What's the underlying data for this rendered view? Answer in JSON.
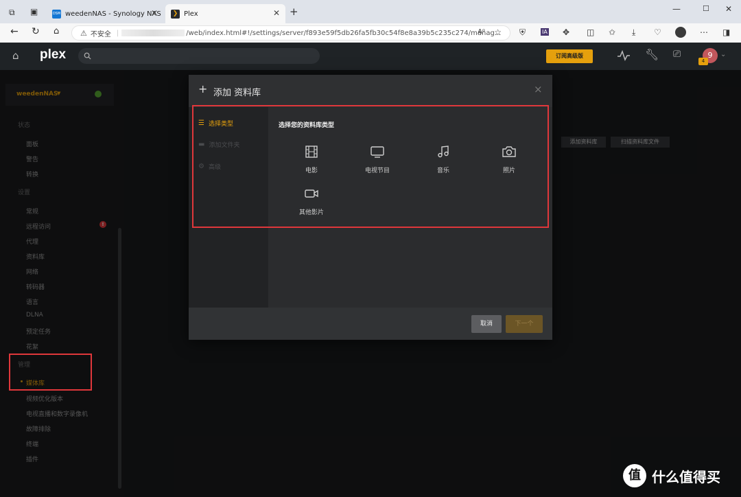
{
  "browser": {
    "tabs": [
      {
        "title": "weedenNAS - Synology NAS",
        "favicon": "DSM",
        "active": false
      },
      {
        "title": "Plex",
        "favicon": "plex-chevron",
        "active": true
      }
    ],
    "new_tab": "+",
    "security_label": "不安全",
    "url": "/web/index.html#!/settings/server/f893e59f5db26fa5fb30c54f8e8a39b5c235c274/manag..."
  },
  "topbar": {
    "logo": "plex",
    "search_placeholder": "",
    "premium_button": "订阅高级版",
    "avatar_letter": "9",
    "badge_count": "4"
  },
  "sidebar": {
    "server_name": "weedenNAS",
    "sections": [
      {
        "heading": "状态",
        "items": [
          "面板",
          "警告",
          "转换"
        ]
      },
      {
        "heading": "设置",
        "items": [
          "常规",
          "远程访问",
          "代理",
          "资料库",
          "网络",
          "转码器",
          "语言",
          "DLNA",
          "预定任务",
          "花絮"
        ]
      },
      {
        "heading": "管理",
        "items": [
          "媒体库",
          "视频优化版本",
          "电视直播和数字录像机",
          "故障排除",
          "终端",
          "插件"
        ]
      }
    ],
    "active_item": "媒体库"
  },
  "background_actions": {
    "add_library": "添加资料库",
    "scan_library": "扫描资料库文件"
  },
  "modal": {
    "title": "添加 资料库",
    "close": "×",
    "steps": [
      "选择类型",
      "添加文件夹",
      "高级"
    ],
    "prompt": "选择您的资料库类型",
    "types": [
      "电影",
      "电视节目",
      "音乐",
      "照片",
      "其他影片"
    ],
    "cancel": "取消",
    "next": "下一个"
  },
  "colors": {
    "accent": "#e5a00d",
    "alert": "#e0373b",
    "online": "#58a832"
  },
  "watermark": "什么值得买"
}
